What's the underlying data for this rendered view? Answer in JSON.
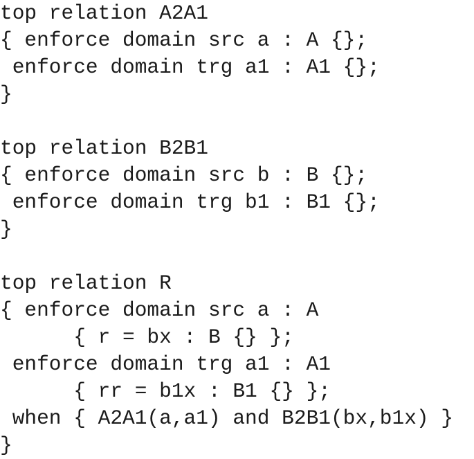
{
  "document": {
    "kind": "code-listing",
    "language": "QVT-R",
    "background_color": "#ffffff",
    "text_color": "#1b1b1b"
  },
  "code": {
    "lines": [
      "top relation A2A1",
      "{ enforce domain src a : A {};",
      " enforce domain trg a1 : A1 {};",
      "}",
      "",
      "top relation B2B1",
      "{ enforce domain src b : B {};",
      " enforce domain trg b1 : B1 {};",
      "}",
      "",
      "top relation R",
      "{ enforce domain src a : A",
      "      { r = bx : B {} };",
      " enforce domain trg a1 : A1",
      "      { rr = b1x : B1 {} };",
      " when { A2A1(a,a1) and B2B1(bx,b1x) }",
      "}"
    ]
  }
}
